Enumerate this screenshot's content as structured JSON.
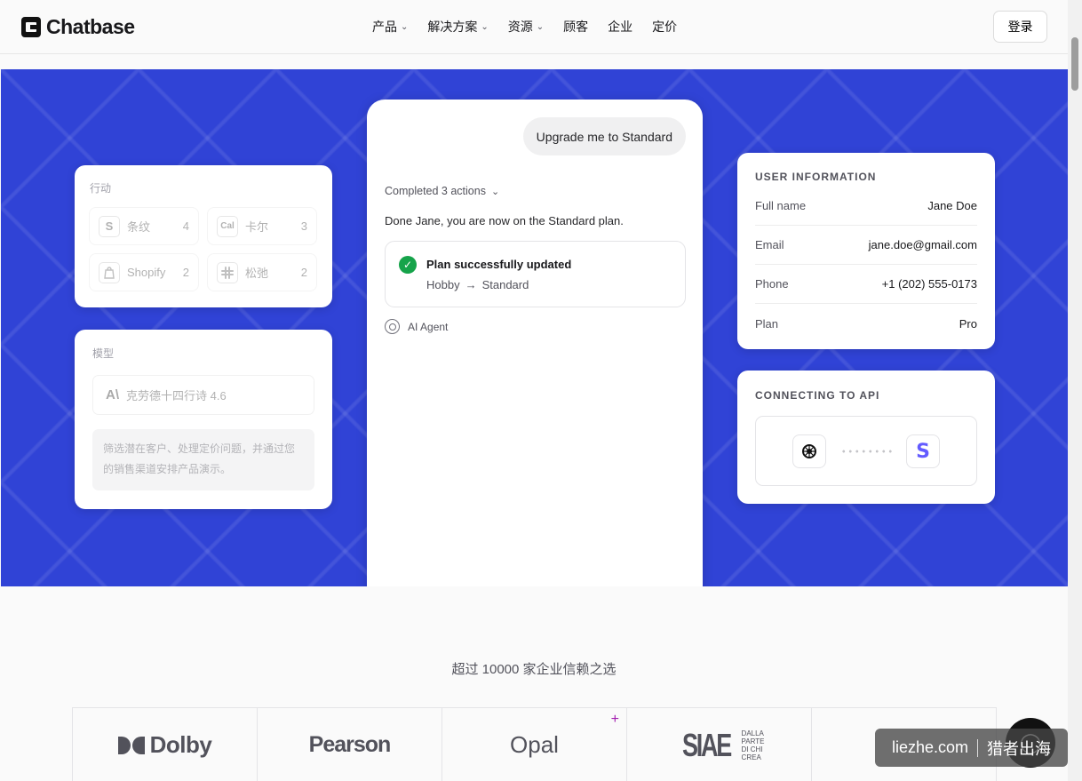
{
  "nav": {
    "brand": "Chatbase",
    "links": [
      {
        "label": "产品",
        "dropdown": true
      },
      {
        "label": "解决方案",
        "dropdown": true
      },
      {
        "label": "资源",
        "dropdown": true
      },
      {
        "label": "顾客",
        "dropdown": false
      },
      {
        "label": "企业",
        "dropdown": false
      },
      {
        "label": "定价",
        "dropdown": false
      }
    ],
    "login": "登录"
  },
  "actions_card": {
    "label": "行动",
    "items": [
      {
        "icon": "S",
        "name": "条纹",
        "count": "4"
      },
      {
        "icon": "Cal",
        "name": "卡尔",
        "count": "3"
      },
      {
        "icon": "shopify-icon",
        "name": "Shopify",
        "count": "2"
      },
      {
        "icon": "slack-icon",
        "name": "松弛",
        "count": "2"
      }
    ]
  },
  "model_card": {
    "label": "模型",
    "model_logo": "A\\",
    "model_name": "克劳德十四行诗 4.6",
    "prompt": "筛选潜在客户、处理定价问题，并通过您的销售渠道安排产品演示。"
  },
  "chat": {
    "user_message": "Upgrade me to Standard",
    "completed": "Completed 3 actions",
    "done_text": "Done Jane, you are now on the Standard plan.",
    "plan_title": "Plan successfully updated",
    "plan_from": "Hobby",
    "plan_arrow": "→",
    "plan_to": "Standard",
    "agent": "AI Agent"
  },
  "user_info": {
    "title": "USER INFORMATION",
    "rows": [
      {
        "key": "Full name",
        "value": "Jane Doe"
      },
      {
        "key": "Email",
        "value": "jane.doe@gmail.com"
      },
      {
        "key": "Phone",
        "value": "+1 (202) 555-0173"
      },
      {
        "key": "Plan",
        "value": "Pro"
      }
    ]
  },
  "api": {
    "title": "CONNECTING TO API",
    "right_icon": "S"
  },
  "trust": {
    "text": "超过 10000 家企业信赖之选",
    "logos": {
      "dolby": "Dolby",
      "pearson": "Pearson",
      "opal": "Opal",
      "siae": "SIAE",
      "siae_sub": [
        "DALLA",
        "PARTE",
        "DI CHI",
        "CREA"
      ]
    }
  },
  "watermark": {
    "left": "liezhe.com",
    "right": "猎者出海"
  },
  "colors": {
    "hero": "#3043d6",
    "success": "#16a34a",
    "stripe": "#635bff"
  }
}
